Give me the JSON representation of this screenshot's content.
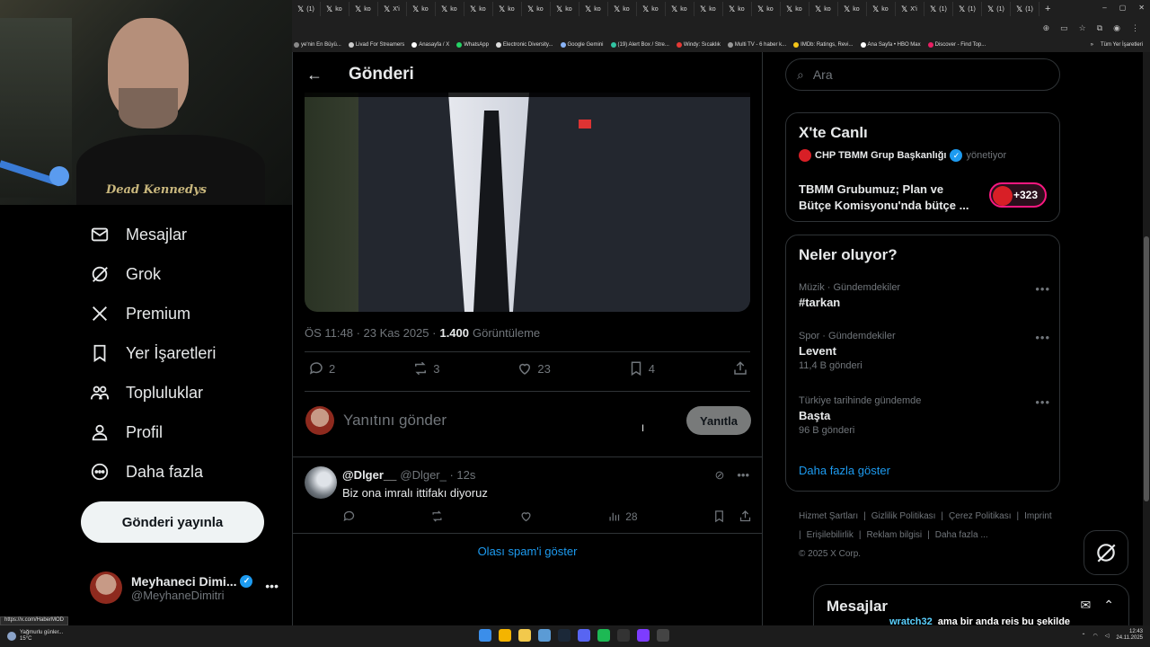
{
  "browser": {
    "tabs": [
      {
        "label": "(1)",
        "icon": "x-icon"
      },
      {
        "label": "ko",
        "icon": "x-icon"
      },
      {
        "label": "ko",
        "icon": "x-icon"
      },
      {
        "label": "X'i",
        "icon": "x-icon"
      },
      {
        "label": "ko",
        "icon": "x-icon"
      },
      {
        "label": "ko",
        "icon": "x-icon"
      },
      {
        "label": "ko",
        "icon": "x-icon"
      },
      {
        "label": "ko",
        "icon": "x-icon"
      },
      {
        "label": "ko",
        "icon": "x-icon"
      },
      {
        "label": "ko",
        "icon": "x-icon"
      },
      {
        "label": "ko",
        "icon": "x-icon"
      },
      {
        "label": "ko",
        "icon": "x-icon"
      },
      {
        "label": "ko",
        "icon": "x-icon"
      },
      {
        "label": "ko",
        "icon": "x-icon"
      },
      {
        "label": "ko",
        "icon": "x-icon"
      },
      {
        "label": "ko",
        "icon": "x-icon"
      },
      {
        "label": "ko",
        "icon": "x-icon"
      },
      {
        "label": "ko",
        "icon": "x-icon"
      },
      {
        "label": "ko",
        "icon": "x-icon"
      },
      {
        "label": "ko",
        "icon": "x-icon"
      },
      {
        "label": "ko",
        "icon": "x-icon"
      },
      {
        "label": "X'i",
        "icon": "x-icon"
      },
      {
        "label": "(1)",
        "icon": "x-icon"
      },
      {
        "label": "(1)",
        "icon": "x-icon"
      },
      {
        "label": "(1)",
        "icon": "x-icon"
      },
      {
        "label": "(1)",
        "icon": "x-icon"
      }
    ],
    "bookmarks": [
      {
        "label": "ye'nin En Büyü...",
        "color": "#888888"
      },
      {
        "label": "Livad For Streamers",
        "color": "#cccccc"
      },
      {
        "label": "Anasayfa / X",
        "color": "#ffffff"
      },
      {
        "label": "WhatsApp",
        "color": "#25d366"
      },
      {
        "label": "Electronic Diversity...",
        "color": "#dddddd"
      },
      {
        "label": "Google Gemini",
        "color": "#8ab4f8"
      },
      {
        "label": "(19) Alert Box / Stre...",
        "color": "#31c3a2"
      },
      {
        "label": "Windy: Sıcaklık",
        "color": "#e53935"
      },
      {
        "label": "Multi TV - 6 haber k...",
        "color": "#999999"
      },
      {
        "label": "IMDb: Ratings, Revi...",
        "color": "#f5c518"
      },
      {
        "label": "Ana Sayfa • HBO Max",
        "color": "#ffffff"
      },
      {
        "label": "Discover - Find Top...",
        "color": "#e91e63"
      }
    ],
    "all_bookmarks": "Tüm Yer İşaretleri"
  },
  "webcam": {
    "shirt_text": "Dead Kennedys"
  },
  "nav": {
    "items": [
      {
        "label": "Mesajlar",
        "icon": "envelope-icon"
      },
      {
        "label": "Grok",
        "icon": "grok-icon"
      },
      {
        "label": "Premium",
        "icon": "x-logo-icon"
      },
      {
        "label": "Yer İşaretleri",
        "icon": "bookmark-icon"
      },
      {
        "label": "Topluluklar",
        "icon": "people-icon"
      },
      {
        "label": "Profil",
        "icon": "person-icon"
      },
      {
        "label": "Daha fazla",
        "icon": "more-circle-icon"
      }
    ],
    "post_button": "Gönderi yayınla",
    "account": {
      "name": "Meyhaneci Dimi...",
      "handle": "@MeyhaneDimitri"
    }
  },
  "main": {
    "title": "Gönderi",
    "meta": {
      "time": "ÖS 11:48 · 23 Kas 2025 ·",
      "views": "1.400",
      "views_label": "Görüntüleme"
    },
    "actions": {
      "replies": "2",
      "reposts": "3",
      "likes": "23",
      "bookmarks": "4"
    },
    "reply_box": {
      "placeholder": "Yanıtını gönder",
      "button": "Yanıtla"
    },
    "reply": {
      "name": "@Dlger__",
      "handle": "@Dlger_ · 12s",
      "text": "Biz ona imralı ittifakı diyoruz",
      "views": "28"
    },
    "spam_link": "Olası spam'i göster"
  },
  "right": {
    "search_placeholder": "Ara",
    "live": {
      "title": "X'te Canlı",
      "host": "CHP TBMM Grup Başkanlığı",
      "role": "yönetiyor",
      "text": "TBMM Grubumuz; Plan ve Bütçe Komisyonu'nda bütçe ...",
      "count": "+323"
    },
    "trends": {
      "title": "Neler oluyor?",
      "items": [
        {
          "category": "Müzik · Gündemdekiler",
          "name": "#tarkan",
          "count": ""
        },
        {
          "category": "Spor · Gündemdekiler",
          "name": "Levent",
          "count": "11,4 B gönderi"
        },
        {
          "category": "Türkiye tarihinde gündemde",
          "name": "Başta",
          "count": "96 B gönderi"
        }
      ],
      "show_more": "Daha fazla göster"
    },
    "footer": {
      "links": [
        "Hizmet Şartları",
        "|",
        "Gizlilik Politikası",
        "|",
        "Çerez Politikası",
        "|",
        "Imprint",
        "|",
        "Erişilebilirlik",
        "|",
        "Reklam bilgisi",
        "|",
        "Daha fazla ...",
        "© 2025 X Corp."
      ]
    },
    "messages_drawer": "Mesajlar"
  },
  "chat_overlay": {
    "user": "wratch32",
    "message": "ama bir anda reis bu şekilde konuşanları partiden yollarsa"
  },
  "status_url": "https://x.com/HaberMOD",
  "taskbar": {
    "weather_line1": "Yağmurlu günler...",
    "weather_line2": "15°C",
    "time": "12:43",
    "date": "24.11.2025"
  }
}
